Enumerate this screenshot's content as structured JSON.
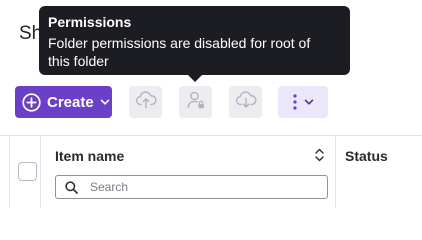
{
  "page": {
    "title": "Sh"
  },
  "tooltip": {
    "title": "Permissions",
    "body_line1": "Folder permissions are disabled for root of",
    "body_line2": "this folder"
  },
  "toolbar": {
    "create_label": "Create",
    "icons": [
      "plus-circle-icon",
      "chevron-down-icon",
      "cloud-upload-icon",
      "user-lock-icon",
      "cloud-download-icon",
      "more-vertical-icon"
    ]
  },
  "table": {
    "columns": [
      "Item name",
      "Status"
    ],
    "search_placeholder": "Search",
    "search_value": ""
  },
  "colors": {
    "primary": "#6b3fc8",
    "tooltip_bg": "#1c1d22",
    "disabled_button_bg": "#ececf1",
    "secondary_button_bg": "#ebe6f8"
  }
}
